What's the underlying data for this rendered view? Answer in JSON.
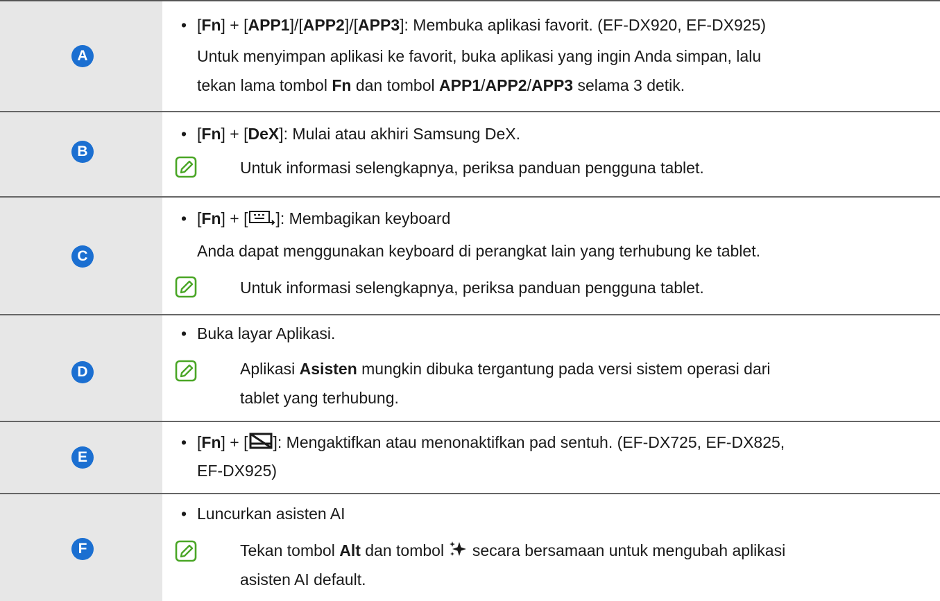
{
  "colors": {
    "badge": "#1b6fd1",
    "label_bg": "#e7e7e7",
    "note_icon": "#4aa626"
  },
  "rows": [
    {
      "letter": "A",
      "l1": [
        "[",
        "Fn",
        "] + [",
        "APP1",
        "]/[",
        "APP2",
        "]/[",
        "APP3",
        "]: Membuka aplikasi favorit. (EF-DX920, EF-DX925)"
      ],
      "l2": "Untuk menyimpan aplikasi ke favorit, buka aplikasi yang ingin Anda simpan, lalu",
      "l3": [
        "tekan lama tombol ",
        "Fn",
        " dan tombol ",
        "APP1",
        "/",
        "APP2",
        "/",
        "APP3",
        " selama 3 detik."
      ]
    },
    {
      "letter": "B",
      "l1": [
        "[",
        "Fn",
        "] + [",
        "DeX",
        "]: Mulai atau akhiri Samsung DeX."
      ],
      "note": "Untuk informasi selengkapnya, periksa panduan pengguna tablet."
    },
    {
      "letter": "C",
      "l1": [
        "[",
        "Fn",
        "] + [",
        "]: Membagikan keyboard"
      ],
      "l2": "Anda dapat menggunakan keyboard di perangkat lain yang terhubung ke tablet.",
      "note": "Untuk informasi selengkapnya, periksa panduan pengguna tablet.",
      "icon": "keyboard-share-icon"
    },
    {
      "letter": "D",
      "l1": "Buka layar Aplikasi.",
      "note": [
        "Aplikasi ",
        "Asisten",
        " mungkin dibuka tergantung pada versi sistem operasi dari"
      ],
      "note2": "tablet yang terhubung."
    },
    {
      "letter": "E",
      "l1": [
        "[",
        "Fn",
        "] + [",
        "]: Mengaktifkan atau menonaktifkan pad sentuh. (EF-DX725, EF-DX825,"
      ],
      "l2": "EF-DX925)",
      "icon": "touchpad-off-icon"
    },
    {
      "letter": "F",
      "l1": "Luncurkan asisten AI",
      "note": [
        "Tekan tombol ",
        "Alt",
        " dan tombol ",
        " secara bersamaan untuk mengubah aplikasi"
      ],
      "note2": "asisten AI default.",
      "icon": "ai-sparkle-icon"
    }
  ]
}
